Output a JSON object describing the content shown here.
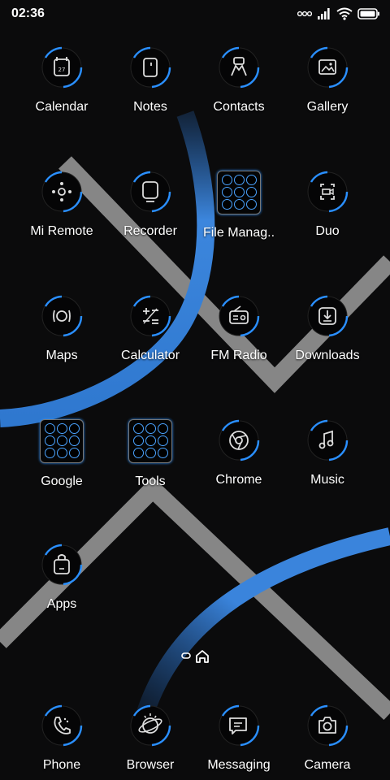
{
  "status_bar": {
    "time": "02:36",
    "icons": [
      "ellipsis-icon",
      "signal-icon",
      "wifi-icon",
      "battery-icon"
    ]
  },
  "colors": {
    "accent": "#2a8fff",
    "background": "#0b0b0c",
    "stripe": "#9a9a9a"
  },
  "apps": [
    {
      "id": "calendar",
      "label": "Calendar",
      "icon": "calendar-icon",
      "badge": "27"
    },
    {
      "id": "notes",
      "label": "Notes",
      "icon": "notes-icon"
    },
    {
      "id": "contacts",
      "label": "Contacts",
      "icon": "contacts-icon"
    },
    {
      "id": "gallery",
      "label": "Gallery",
      "icon": "gallery-icon"
    },
    {
      "id": "mi-remote",
      "label": "Mi Remote",
      "icon": "remote-icon"
    },
    {
      "id": "recorder",
      "label": "Recorder",
      "icon": "recorder-icon"
    },
    {
      "id": "file-manager",
      "label": "File Manag..",
      "icon": "folder-icon"
    },
    {
      "id": "duo",
      "label": "Duo",
      "icon": "video-call-icon"
    },
    {
      "id": "maps",
      "label": "Maps",
      "icon": "maps-icon"
    },
    {
      "id": "calculator",
      "label": "Calculator",
      "icon": "calculator-icon"
    },
    {
      "id": "fm-radio",
      "label": "FM Radio",
      "icon": "radio-icon"
    },
    {
      "id": "downloads",
      "label": "Downloads",
      "icon": "download-icon"
    },
    {
      "id": "google",
      "label": "Google",
      "icon": "folder-google-icon"
    },
    {
      "id": "tools",
      "label": "Tools",
      "icon": "folder-tools-icon"
    },
    {
      "id": "chrome",
      "label": "Chrome",
      "icon": "chrome-icon"
    },
    {
      "id": "music",
      "label": "Music",
      "icon": "music-icon"
    },
    {
      "id": "apps",
      "label": "Apps",
      "icon": "shopping-bag-icon"
    }
  ],
  "dock": [
    {
      "id": "phone",
      "label": "Phone",
      "icon": "phone-icon"
    },
    {
      "id": "browser",
      "label": "Browser",
      "icon": "browser-icon"
    },
    {
      "id": "messaging",
      "label": "Messaging",
      "icon": "messaging-icon"
    },
    {
      "id": "camera",
      "label": "Camera",
      "icon": "camera-icon"
    }
  ]
}
